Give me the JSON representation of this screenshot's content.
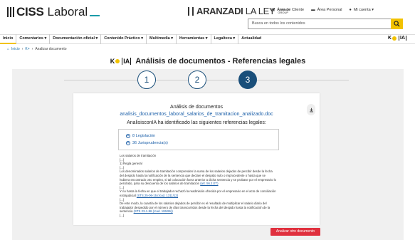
{
  "brand": {
    "name": "CISS",
    "name2": "Laboral"
  },
  "aranzadi": {
    "text_bold": "ARANZADI",
    "text": "LA LEY",
    "kg": "KARNOV GROUP"
  },
  "toplinks": [
    {
      "icon": "building-icon",
      "label": "Área de Cliente"
    },
    {
      "icon": "folder-icon",
      "label": "Área Personal"
    },
    {
      "icon": "user-icon",
      "label": "Mi cuenta"
    }
  ],
  "search": {
    "placeholder": "Busca en todos los contenidos"
  },
  "nav": {
    "items": [
      "Inicio",
      "Comentarios",
      "Documentación oficial",
      "Contenido Práctico",
      "Multimedia",
      "Herramientas",
      "Legalteca",
      "Actualidad"
    ]
  },
  "breadcrumb": [
    "Inicio",
    "K+",
    "Analizar documento"
  ],
  "header": {
    "title": "Análisis de documentos - Referencias legales"
  },
  "steps": [
    "1",
    "2",
    "3"
  ],
  "card": {
    "heading": "Análisis de documentos",
    "filename": "analisis_documentos_laboral_salarios_de_tramitacion_analizado.doc",
    "analysis_text": "AnalisisconIA ha identificado las siguientes referencias legales:",
    "refs": [
      "8 Legislación",
      "36 Jurisprudencia(s)"
    ],
    "body": [
      "Los salarios de tramitación",
      "[...]",
      "1) Regla general",
      "[...]",
      "Los denominados salarios de tramitación comprenden la suma de los salarios dejados de percibir desde la fecha del despido hasta la notificación de la sentencia que declare el despido nulo o improcedente o hasta que se hubiera encontrado otro empleo, si tal colocación fuera anterior a dicha sentencia y se probase por el empresario lo percibido, para su descuento de los salarios de tramitación",
      "[...]",
      "Y no hasta la fecha en que el trabajador rechazó la readmisión ofrecida por el empresario en el acto de conciliación extrajudicial",
      "[...]",
      "De este modo, la cuantía de los salarios dejados de percibir es el resultado de multiplicar el salario diario del trabajador despedido por el número de días transcurridos desde la fecha del despido hasta la notificación de la sentencia",
      "[...]"
    ],
    "links": [
      "(art. 56.2 ET)",
      "(STS 25-06-15 (rcud. 1311/12)",
      "(STS 23-1-96 (rcud. 106/96))"
    ]
  },
  "button": {
    "label": "Analizar otro documento"
  }
}
